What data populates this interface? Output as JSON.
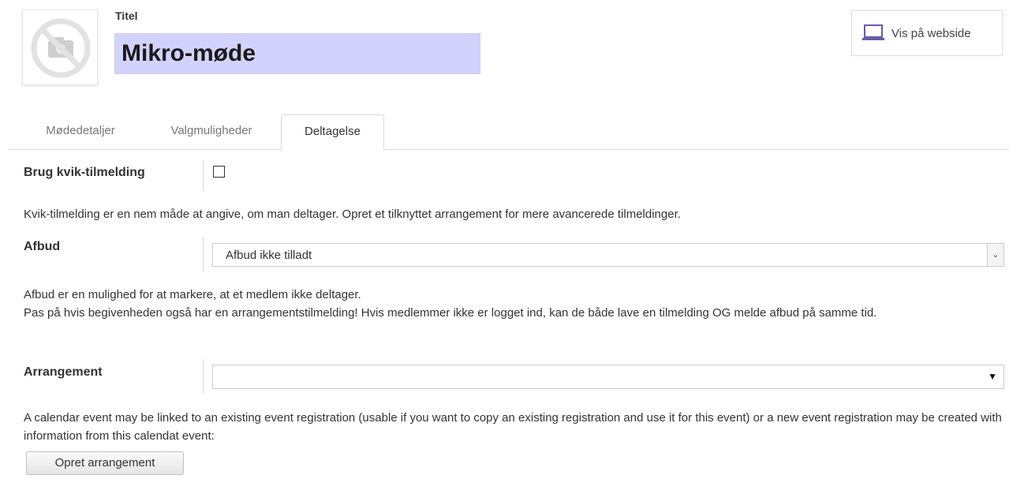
{
  "header": {
    "title_label": "Titel",
    "title_value": "Mikro-møde",
    "web_button_label": "Vis på webside",
    "avatar_icon": "no-photo-icon",
    "title_bg": "#d2d2ff"
  },
  "tabs": [
    {
      "label": "Mødedetaljer",
      "active": false
    },
    {
      "label": "Valgmuligheder",
      "active": false
    },
    {
      "label": "Deltagelse",
      "active": true
    }
  ],
  "form": {
    "quick_signup": {
      "label": "Brug kvik-tilmelding",
      "checked": false,
      "help": "Kvik-tilmelding er en nem måde at angive, om man deltager. Opret et tilknyttet arrangement for mere avancerede tilmeldinger."
    },
    "cancellation": {
      "label": "Afbud",
      "selected": "Afbud ikke tilladt",
      "help_line1": "Afbud er en mulighed for at markere, at et medlem ikke deltager.",
      "help_line2": "Pas på hvis begivenheden også har en arrangementstilmelding! Hvis medlemmer ikke er logget ind, kan de både lave en tilmelding OG melde afbud på samme tid."
    },
    "event": {
      "label": "Arrangement",
      "selected": "",
      "help": "A calendar event may be linked to an existing event registration (usable if you want to copy an existing registration and use it for this event) or a new event registration may be created with information from this calendat event:",
      "create_button": "Opret arrangement"
    }
  }
}
